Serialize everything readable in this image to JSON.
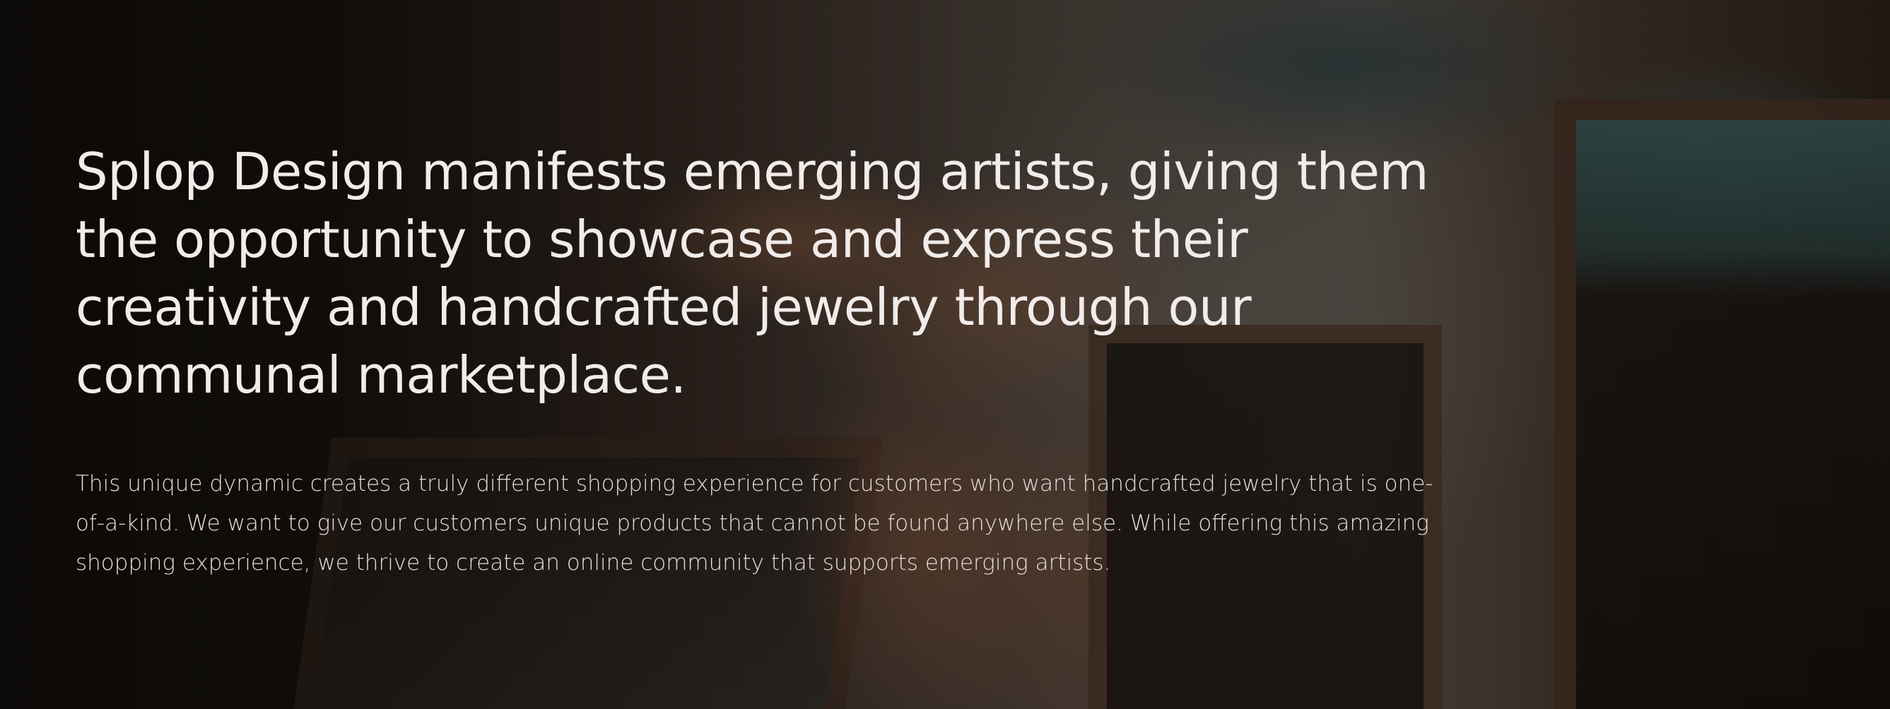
{
  "hero": {
    "headline": "Splop Design manifests emerging artists, giving them the opportunity to showcase and express their creativity and handcrafted jewelry through our communal marketplace.",
    "body": "This unique dynamic creates a truly different shopping experience for customers who want handcrafted jewelry that is one-of-a-kind. We want to give our customers unique products that cannot be found anywhere else. While offering this amazing shopping experience, we thrive to create an online community that supports emerging artists.",
    "background_image": "jewelry-craft-photo",
    "colors": {
      "text_primary": "#f1ecea",
      "text_secondary": "#e4dedb",
      "overlay": "#0a0806"
    }
  }
}
